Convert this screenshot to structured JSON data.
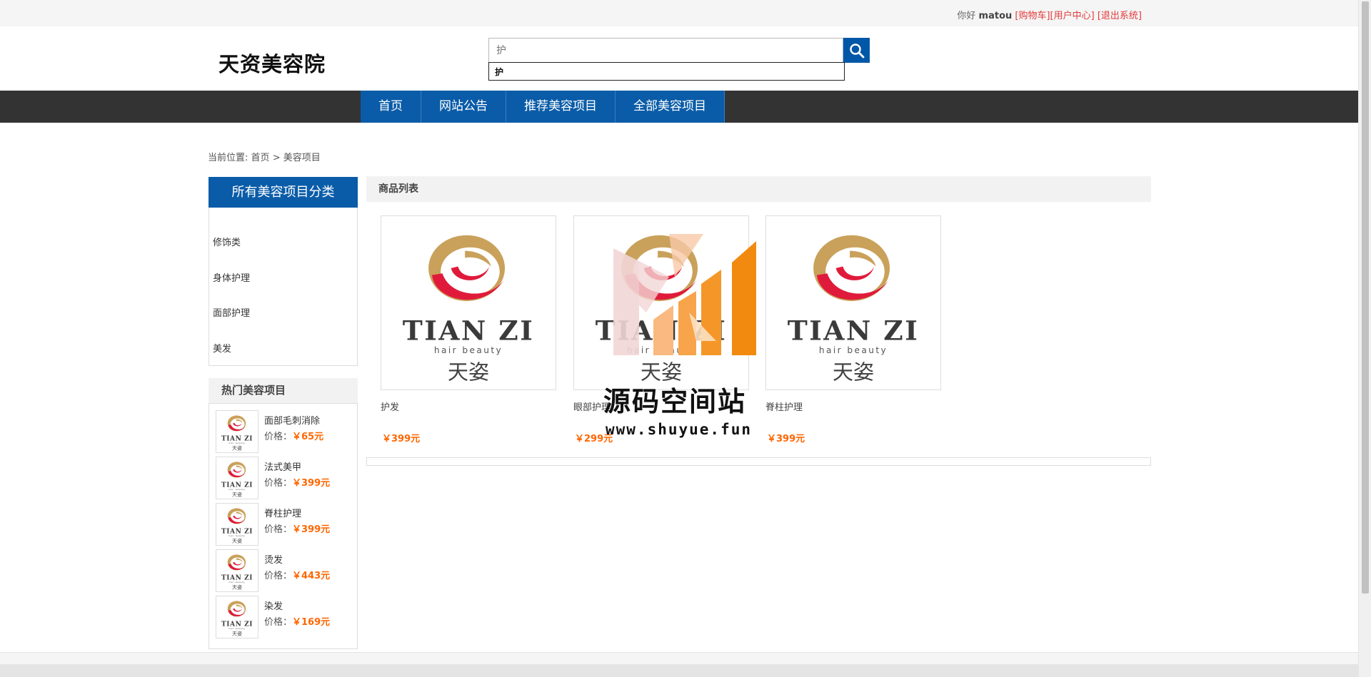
{
  "topbar": {
    "greeting": "你好",
    "username": "matou",
    "cart_link": "[购物车]",
    "user_center_link": "[用户中心]",
    "logout_link": "[退出系统]"
  },
  "header": {
    "logo": "天资美容院",
    "search": {
      "placeholder": "护",
      "value": ""
    },
    "suggestion": "护"
  },
  "nav": {
    "items": [
      "首页",
      "网站公告",
      "推荐美容项目",
      "全部美容项目"
    ]
  },
  "breadcrumb": {
    "prefix": "当前位置:",
    "home": "首页",
    "separator": ">",
    "current": "美容项目"
  },
  "sidebar": {
    "category_title": "所有美容项目分类",
    "categories": [
      "修饰类",
      "身体护理",
      "面部护理",
      "美发"
    ],
    "hot_title": "热门美容项目",
    "price_label": "价格：",
    "hot_items": [
      {
        "name": "面部毛刺消除",
        "price": "￥65元"
      },
      {
        "name": "法式美甲",
        "price": "￥399元"
      },
      {
        "name": "脊柱护理",
        "price": "￥399元"
      },
      {
        "name": "烫发",
        "price": "￥443元"
      },
      {
        "name": "染发",
        "price": "￥169元"
      }
    ]
  },
  "main": {
    "list_title": "商品列表",
    "products": [
      {
        "name": "护发",
        "price": "￥399元"
      },
      {
        "name": "眼部护理",
        "price": "￥299元"
      },
      {
        "name": "脊柱护理",
        "price": "￥399元"
      }
    ]
  },
  "product_logo": {
    "brand": "TIAN ZI",
    "tagline": "hair beauty",
    "cn": "天姿"
  },
  "watermark": {
    "title": "源码空间站",
    "url": "www.shuyue.fun"
  },
  "colors": {
    "accent": "#0a5ca8",
    "price": "#ff6600",
    "link": "#e4393c",
    "nav_bg": "#333333"
  }
}
